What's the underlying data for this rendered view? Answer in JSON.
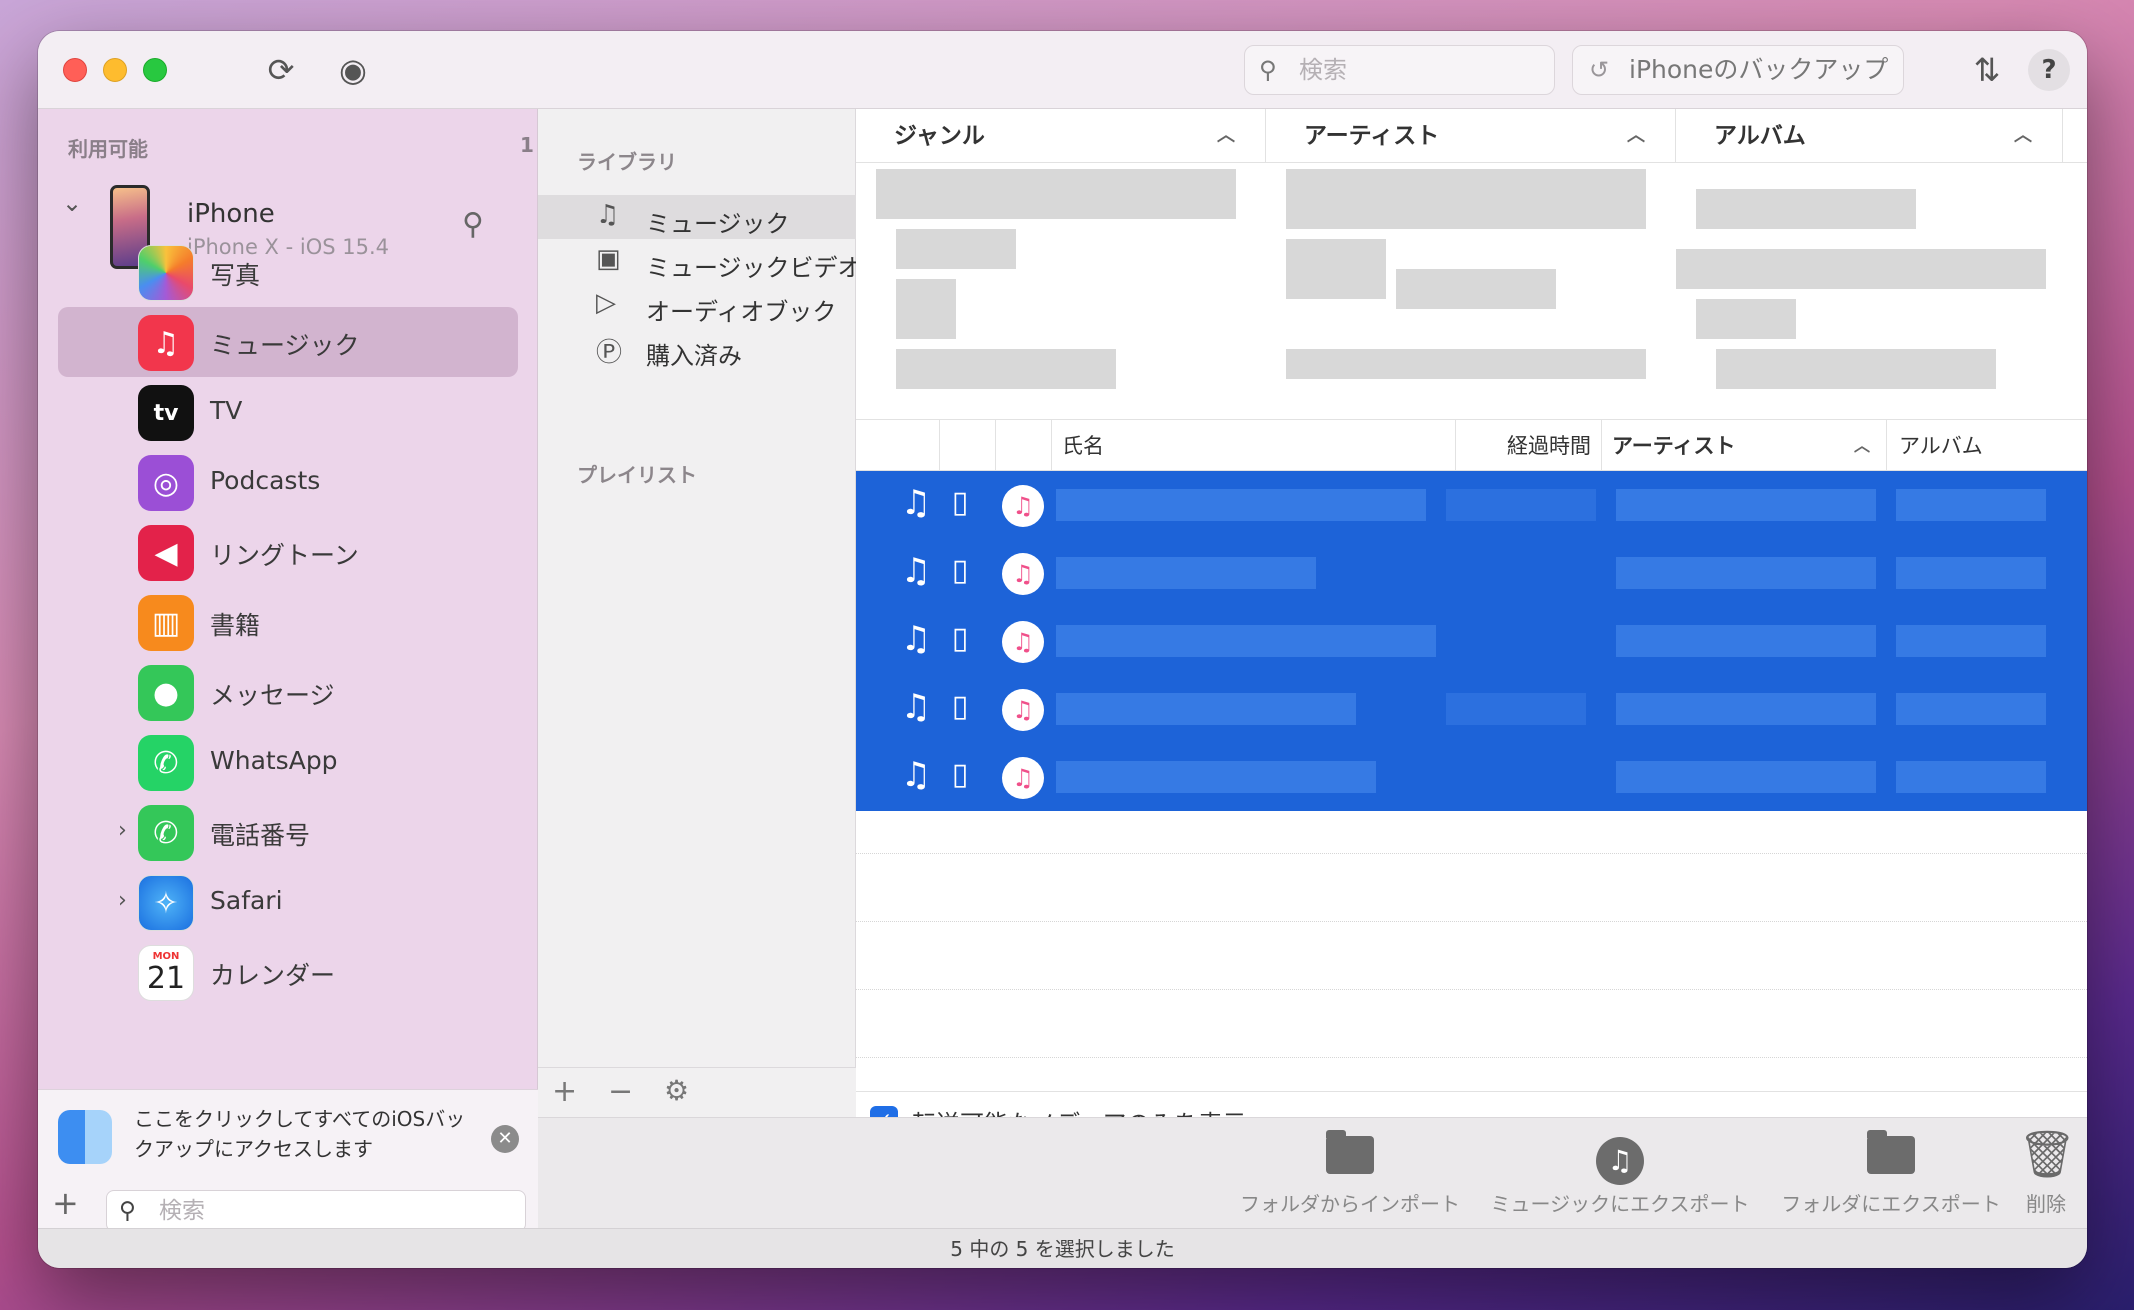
{
  "titlebar": {
    "search_placeholder": "検索",
    "backup_button": "iPhoneのバックアップ",
    "help": "?"
  },
  "sidebar": {
    "section_title": "利用可能",
    "section_count": "1",
    "device": {
      "name": "iPhone",
      "subtitle": "iPhone X - iOS 15.4"
    },
    "items": [
      {
        "label": "写真",
        "icon": "photos-icon",
        "color": "#ffffff"
      },
      {
        "label": "ミュージック",
        "icon": "music-icon",
        "color": "#f2364c",
        "selected": true
      },
      {
        "label": "TV",
        "icon": "tv-icon",
        "color": "#111111"
      },
      {
        "label": "Podcasts",
        "icon": "podcasts-icon",
        "color": "#9b4fd6"
      },
      {
        "label": "リングトーン",
        "icon": "ringtone-icon",
        "color": "#e3224a"
      },
      {
        "label": "書籍",
        "icon": "books-icon",
        "color": "#f78a1d"
      },
      {
        "label": "メッセージ",
        "icon": "messages-icon",
        "color": "#34c759"
      },
      {
        "label": "WhatsApp",
        "icon": "whatsapp-icon",
        "color": "#25d366"
      },
      {
        "label": "電話番号",
        "icon": "phone-icon",
        "color": "#34c759"
      },
      {
        "label": "Safari",
        "icon": "safari-icon",
        "color": "#ffffff"
      },
      {
        "label": "カレンダー",
        "icon": "calendar-icon",
        "color": "#ffffff",
        "cal_day": "MON",
        "cal_date": "21"
      }
    ],
    "notice_text": "ここをクリックしてすべてのiOSバックアップにアクセスします",
    "search_placeholder": "検索"
  },
  "library": {
    "section_title": "ライブラリ",
    "items": [
      {
        "label": "ミュージック",
        "icon": "music-note-icon"
      },
      {
        "label": "ミュージックビデオ",
        "icon": "music-video-icon"
      },
      {
        "label": "オーディオブック",
        "icon": "audiobook-icon"
      },
      {
        "label": "購入済み",
        "icon": "purchased-icon"
      }
    ],
    "playlist_title": "プレイリスト"
  },
  "browser": {
    "columns": [
      "ジャンル",
      "アーティスト",
      "アルバム"
    ]
  },
  "list": {
    "columns": [
      "氏名",
      "経過時間",
      "アーティスト",
      "アルバム"
    ],
    "row_count": 5
  },
  "filter": {
    "label": "転送可能なメディアのみを表示",
    "checked": true
  },
  "toolbar": {
    "import_folder": "フォルダからインポート",
    "export_music": "ミュージックにエクスポート",
    "export_folder": "フォルダにエクスポート",
    "delete": "削除"
  },
  "status": "5 中の 5 を選択しました"
}
